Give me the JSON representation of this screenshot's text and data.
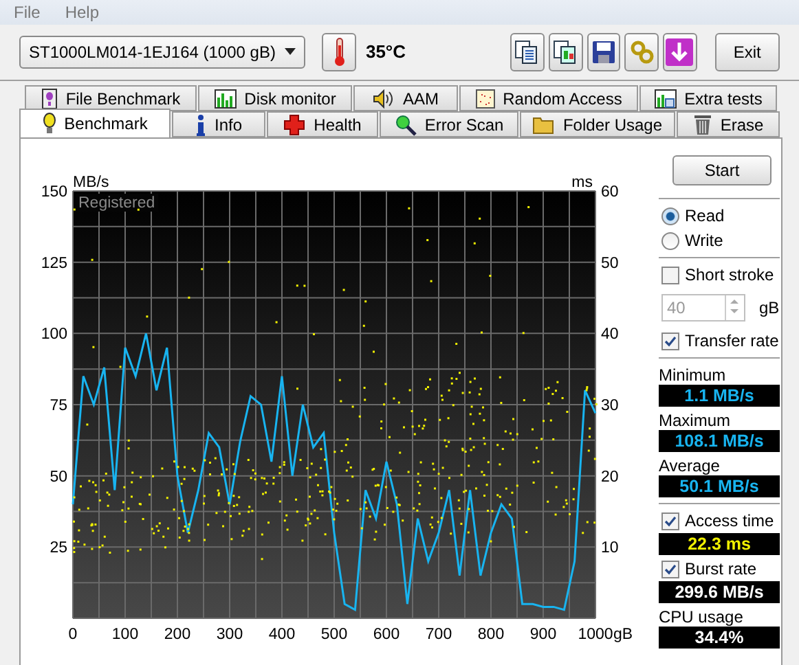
{
  "menu": [
    {
      "label": "File"
    },
    {
      "label": "Help"
    }
  ],
  "toolbar": {
    "drive": "ST1000LM014-1EJ164 (1000 gB)",
    "temperature": "35°C",
    "exit": "Exit"
  },
  "tabs_top": [
    {
      "label": "File Benchmark",
      "selected": false
    },
    {
      "label": "Disk monitor",
      "selected": false
    },
    {
      "label": "AAM",
      "selected": false
    },
    {
      "label": "Random Access",
      "selected": false
    },
    {
      "label": "Extra tests",
      "selected": false
    }
  ],
  "tabs_bottom": [
    {
      "label": "Benchmark",
      "selected": true
    },
    {
      "label": "Info",
      "selected": false
    },
    {
      "label": "Health",
      "selected": false
    },
    {
      "label": "Error Scan",
      "selected": false
    },
    {
      "label": "Folder Usage",
      "selected": false
    },
    {
      "label": "Erase",
      "selected": false
    }
  ],
  "chart": {
    "watermark": "Registered",
    "right_axis": {
      "label": "ms",
      "ticks": [
        "60",
        "50",
        "40",
        "30",
        "20",
        "10"
      ]
    },
    "chart_data": {
      "type": "line",
      "ylabel": "MB/s",
      "xlim": [
        0,
        1000
      ],
      "ylim": [
        0,
        150
      ],
      "xlabel": "gB",
      "grid": true,
      "xticks": [
        0,
        100,
        200,
        300,
        400,
        500,
        600,
        700,
        800,
        900,
        1000
      ],
      "yticks": [
        25,
        50,
        75,
        100,
        125,
        150
      ],
      "x": [
        0,
        20,
        40,
        60,
        80,
        100,
        120,
        140,
        160,
        180,
        200,
        220,
        240,
        260,
        280,
        300,
        320,
        340,
        360,
        380,
        400,
        420,
        440,
        460,
        480,
        500,
        520,
        540,
        560,
        580,
        600,
        620,
        640,
        660,
        680,
        700,
        720,
        740,
        760,
        780,
        800,
        820,
        840,
        860,
        880,
        900,
        920,
        940,
        960,
        980,
        1000
      ],
      "series": [
        {
          "color": "#18b4f0",
          "values": [
            40,
            85,
            75,
            88,
            45,
            95,
            85,
            100,
            80,
            95,
            50,
            30,
            45,
            65,
            60,
            40,
            62,
            78,
            75,
            55,
            85,
            50,
            75,
            60,
            65,
            30,
            5,
            3,
            45,
            35,
            55,
            40,
            5,
            35,
            20,
            30,
            45,
            15,
            45,
            15,
            30,
            40,
            35,
            5,
            5,
            4,
            4,
            3,
            20,
            80,
            72
          ]
        }
      ]
    }
  },
  "controls": {
    "start": "Start",
    "modes": [
      {
        "label": "Read",
        "selected": true
      },
      {
        "label": "Write",
        "selected": false
      }
    ],
    "short_stroke": {
      "label": "Short stroke",
      "checked": false
    },
    "stroke_size": {
      "value": "40",
      "unit": "gB",
      "disabled": true
    },
    "transfer_rate": {
      "label": "Transfer rate",
      "checked": true
    },
    "stats": [
      {
        "label": "Minimum",
        "value": "1.1 MB/s"
      },
      {
        "label": "Maximum",
        "value": "108.1 MB/s"
      },
      {
        "label": "Average",
        "value": "50.1 MB/s"
      }
    ],
    "access_time": {
      "label": "Access time",
      "checked": true,
      "value": "22.3 ms"
    },
    "burst_rate": {
      "label": "Burst rate",
      "checked": true,
      "value": "299.6 MB/s"
    },
    "cpu": {
      "label": "CPU usage",
      "value": "34.4%"
    }
  }
}
